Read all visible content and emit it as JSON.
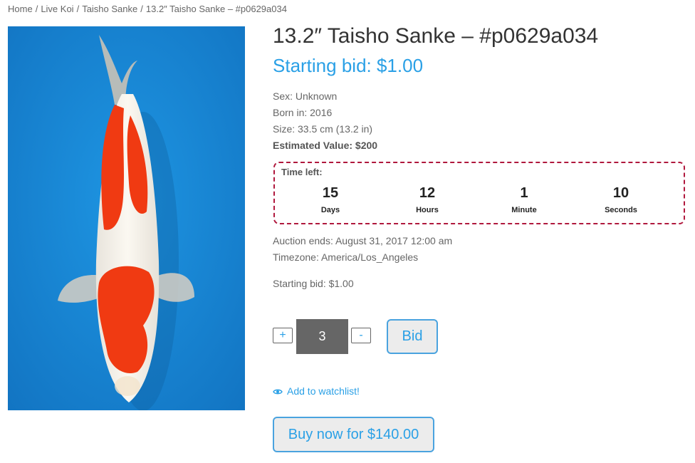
{
  "breadcrumb": {
    "items": [
      "Home",
      "Live Koi",
      "Taisho Sanke",
      "13.2″ Taisho Sanke – #p0629a034"
    ],
    "separator": "/"
  },
  "product": {
    "title": "13.2″ Taisho Sanke – #p0629a034",
    "starting_bid_heading": "Starting bid: $1.00",
    "sex": "Sex: Unknown",
    "born": "Born in: 2016",
    "size": "Size: 33.5 cm (13.2 in)",
    "estimated_value": "Estimated Value: $200"
  },
  "timer": {
    "label": "Time left:",
    "units": [
      {
        "value": "15",
        "label": "Days"
      },
      {
        "value": "12",
        "label": "Hours"
      },
      {
        "value": "1",
        "label": "Minute"
      },
      {
        "value": "10",
        "label": "Seconds"
      }
    ],
    "border_color": "#b0183d"
  },
  "auction": {
    "ends": "Auction ends: August 31, 2017 12:00 am",
    "timezone": "Timezone: America/Los_Angeles",
    "starting_bid": "Starting bid: $1.00"
  },
  "bid_form": {
    "plus_label": "+",
    "minus_label": "-",
    "quantity": "3",
    "bid_label": "Bid"
  },
  "watchlist": {
    "label": "Add to watchlist!",
    "icon": "eye-icon"
  },
  "buy_now": {
    "label": "Buy now for $140.00"
  },
  "colors": {
    "accent": "#2aa0e6",
    "photo_bg": "#1a86d4",
    "koi_red": "#f03a12"
  }
}
